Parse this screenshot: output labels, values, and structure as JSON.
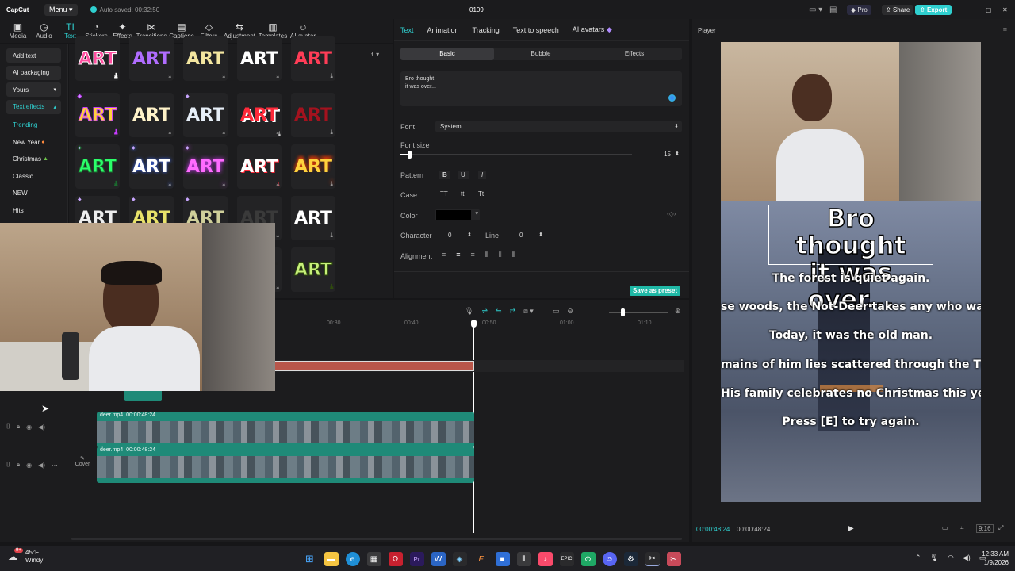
{
  "titlebar": {
    "app_name": "CapCut",
    "menu_label": "Menu",
    "autosave": "Auto saved: 00:32:50",
    "project_name": "0109",
    "pro_label": "Pro",
    "share_label": "Share",
    "export_label": "Export",
    "min": "─",
    "max": "▢",
    "close": "✕"
  },
  "toolbar": [
    {
      "label": "Media",
      "icon": "▣"
    },
    {
      "label": "Audio",
      "icon": "◷"
    },
    {
      "label": "Text",
      "icon": "TI"
    },
    {
      "label": "Stickers",
      "icon": "◔"
    },
    {
      "label": "Effects",
      "icon": "✦"
    },
    {
      "label": "Transitions",
      "icon": "⋈"
    },
    {
      "label": "Captions",
      "icon": "▤"
    },
    {
      "label": "Filters",
      "icon": "◇"
    },
    {
      "label": "Adjustment",
      "icon": "⇆"
    },
    {
      "label": "Templates",
      "icon": "▥"
    },
    {
      "label": "AI avatar",
      "icon": "☺"
    }
  ],
  "leftnav": {
    "add_text": "Add text",
    "ai_packaging": "AI packaging",
    "yours": "Yours",
    "text_effects": "Text effects",
    "items": [
      "Trending",
      "New Year",
      "Christmas",
      "Classic",
      "NEW",
      "Hits"
    ]
  },
  "library": {
    "filter_icon": "filter-icon",
    "tile_text": "ART"
  },
  "textpanel": {
    "tabs": [
      "Text",
      "Animation",
      "Tracking",
      "Text to speech",
      "AI avatars"
    ],
    "subtabs": [
      "Basic",
      "Bubble",
      "Effects"
    ],
    "text_value_line1": "Bro thought",
    "text_value_line2": "it was over...",
    "font_label": "Font",
    "font_value": "System",
    "font_size_label": "Font size",
    "font_size_value": "15",
    "pattern_label": "Pattern",
    "pattern_b": "B",
    "pattern_u": "U",
    "pattern_i": "I",
    "case_label": "Case",
    "case_tt1": "TT",
    "case_tt2": "tt",
    "case_tt3": "Tt",
    "color_label": "Color",
    "color_value": "#000000",
    "character_label": "Character",
    "character_value": "0",
    "line_label": "Line",
    "line_value": "0",
    "alignment_label": "Alignment",
    "save_preset": "Save as preset"
  },
  "player": {
    "title": "Player",
    "overlay_line1": "Bro thought",
    "overlay_line2": "it was over...",
    "captions": [
      "The forest is quiet again.",
      "se woods, the Not-Deer takes any who wander",
      "Today, it was the old man.",
      "mains of him lies scattered through the Timber",
      "His family celebrates no Christmas this year",
      "Press [E] to try again."
    ],
    "time_current": "00:00:48:24",
    "time_total": "00:00:48:24",
    "ratio": "9:16"
  },
  "timeline": {
    "ruler": [
      "00:30",
      "00:40",
      "00:50",
      "01:00",
      "01:10"
    ],
    "clip1_name": "deer.mp4",
    "clip1_duration": "00:00:48:24",
    "clip2_name": "deer.mp4",
    "clip2_duration": "00:00:48:24",
    "cover_label": "Cover"
  },
  "taskbar": {
    "weather_temp": "45°F",
    "weather_desc": "Windy",
    "badge": "9+",
    "time": "12:33 AM",
    "date": "1/9/2026"
  },
  "colors": {
    "accent": "#2fcfcf",
    "panel": "#1c1c1e",
    "track": "#1f8a78",
    "red_track": "#b8564a"
  }
}
